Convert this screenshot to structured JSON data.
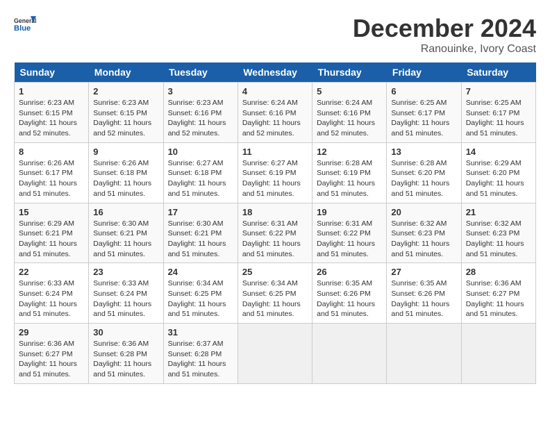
{
  "header": {
    "logo_line1": "General",
    "logo_line2": "Blue",
    "month": "December 2024",
    "location": "Ranouinke, Ivory Coast"
  },
  "days_of_week": [
    "Sunday",
    "Monday",
    "Tuesday",
    "Wednesday",
    "Thursday",
    "Friday",
    "Saturday"
  ],
  "weeks": [
    [
      {
        "day": "1",
        "info": "Sunrise: 6:23 AM\nSunset: 6:15 PM\nDaylight: 11 hours\nand 52 minutes."
      },
      {
        "day": "2",
        "info": "Sunrise: 6:23 AM\nSunset: 6:15 PM\nDaylight: 11 hours\nand 52 minutes."
      },
      {
        "day": "3",
        "info": "Sunrise: 6:23 AM\nSunset: 6:16 PM\nDaylight: 11 hours\nand 52 minutes."
      },
      {
        "day": "4",
        "info": "Sunrise: 6:24 AM\nSunset: 6:16 PM\nDaylight: 11 hours\nand 52 minutes."
      },
      {
        "day": "5",
        "info": "Sunrise: 6:24 AM\nSunset: 6:16 PM\nDaylight: 11 hours\nand 52 minutes."
      },
      {
        "day": "6",
        "info": "Sunrise: 6:25 AM\nSunset: 6:17 PM\nDaylight: 11 hours\nand 51 minutes."
      },
      {
        "day": "7",
        "info": "Sunrise: 6:25 AM\nSunset: 6:17 PM\nDaylight: 11 hours\nand 51 minutes."
      }
    ],
    [
      {
        "day": "8",
        "info": "Sunrise: 6:26 AM\nSunset: 6:17 PM\nDaylight: 11 hours\nand 51 minutes."
      },
      {
        "day": "9",
        "info": "Sunrise: 6:26 AM\nSunset: 6:18 PM\nDaylight: 11 hours\nand 51 minutes."
      },
      {
        "day": "10",
        "info": "Sunrise: 6:27 AM\nSunset: 6:18 PM\nDaylight: 11 hours\nand 51 minutes."
      },
      {
        "day": "11",
        "info": "Sunrise: 6:27 AM\nSunset: 6:19 PM\nDaylight: 11 hours\nand 51 minutes."
      },
      {
        "day": "12",
        "info": "Sunrise: 6:28 AM\nSunset: 6:19 PM\nDaylight: 11 hours\nand 51 minutes."
      },
      {
        "day": "13",
        "info": "Sunrise: 6:28 AM\nSunset: 6:20 PM\nDaylight: 11 hours\nand 51 minutes."
      },
      {
        "day": "14",
        "info": "Sunrise: 6:29 AM\nSunset: 6:20 PM\nDaylight: 11 hours\nand 51 minutes."
      }
    ],
    [
      {
        "day": "15",
        "info": "Sunrise: 6:29 AM\nSunset: 6:21 PM\nDaylight: 11 hours\nand 51 minutes."
      },
      {
        "day": "16",
        "info": "Sunrise: 6:30 AM\nSunset: 6:21 PM\nDaylight: 11 hours\nand 51 minutes."
      },
      {
        "day": "17",
        "info": "Sunrise: 6:30 AM\nSunset: 6:21 PM\nDaylight: 11 hours\nand 51 minutes."
      },
      {
        "day": "18",
        "info": "Sunrise: 6:31 AM\nSunset: 6:22 PM\nDaylight: 11 hours\nand 51 minutes."
      },
      {
        "day": "19",
        "info": "Sunrise: 6:31 AM\nSunset: 6:22 PM\nDaylight: 11 hours\nand 51 minutes."
      },
      {
        "day": "20",
        "info": "Sunrise: 6:32 AM\nSunset: 6:23 PM\nDaylight: 11 hours\nand 51 minutes."
      },
      {
        "day": "21",
        "info": "Sunrise: 6:32 AM\nSunset: 6:23 PM\nDaylight: 11 hours\nand 51 minutes."
      }
    ],
    [
      {
        "day": "22",
        "info": "Sunrise: 6:33 AM\nSunset: 6:24 PM\nDaylight: 11 hours\nand 51 minutes."
      },
      {
        "day": "23",
        "info": "Sunrise: 6:33 AM\nSunset: 6:24 PM\nDaylight: 11 hours\nand 51 minutes."
      },
      {
        "day": "24",
        "info": "Sunrise: 6:34 AM\nSunset: 6:25 PM\nDaylight: 11 hours\nand 51 minutes."
      },
      {
        "day": "25",
        "info": "Sunrise: 6:34 AM\nSunset: 6:25 PM\nDaylight: 11 hours\nand 51 minutes."
      },
      {
        "day": "26",
        "info": "Sunrise: 6:35 AM\nSunset: 6:26 PM\nDaylight: 11 hours\nand 51 minutes."
      },
      {
        "day": "27",
        "info": "Sunrise: 6:35 AM\nSunset: 6:26 PM\nDaylight: 11 hours\nand 51 minutes."
      },
      {
        "day": "28",
        "info": "Sunrise: 6:36 AM\nSunset: 6:27 PM\nDaylight: 11 hours\nand 51 minutes."
      }
    ],
    [
      {
        "day": "29",
        "info": "Sunrise: 6:36 AM\nSunset: 6:27 PM\nDaylight: 11 hours\nand 51 minutes."
      },
      {
        "day": "30",
        "info": "Sunrise: 6:36 AM\nSunset: 6:28 PM\nDaylight: 11 hours\nand 51 minutes."
      },
      {
        "day": "31",
        "info": "Sunrise: 6:37 AM\nSunset: 6:28 PM\nDaylight: 11 hours\nand 51 minutes."
      },
      {
        "day": "",
        "info": ""
      },
      {
        "day": "",
        "info": ""
      },
      {
        "day": "",
        "info": ""
      },
      {
        "day": "",
        "info": ""
      }
    ]
  ]
}
